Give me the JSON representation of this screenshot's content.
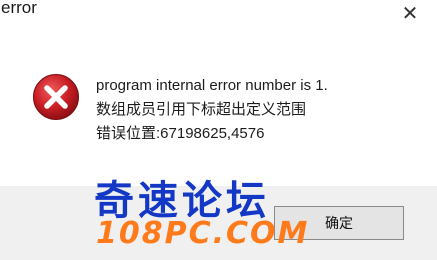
{
  "window": {
    "title": "error",
    "close_label": "✕"
  },
  "message": {
    "line1": "program internal error number is 1.",
    "line2": "数组成员引用下标超出定义范围",
    "line3": "错误位置:67198625,4576"
  },
  "icon": {
    "name": "error-icon",
    "color": "#c81e24"
  },
  "buttons": {
    "ok_label": "确定"
  },
  "watermark": {
    "line1": "奇速论坛",
    "line2": "108PC.COM"
  }
}
